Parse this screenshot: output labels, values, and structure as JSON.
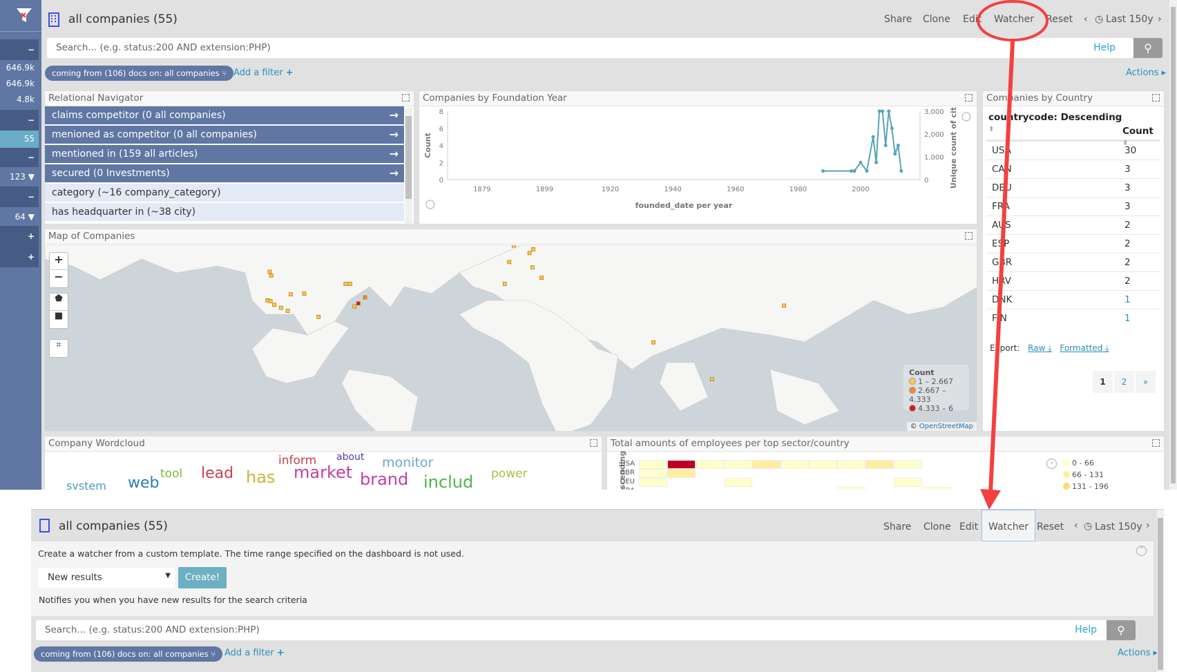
{
  "sidebar": {
    "items": [
      {
        "value": "",
        "control": "−"
      },
      {
        "value": "646.9k"
      },
      {
        "value": "646.9k"
      },
      {
        "value": "4.8k"
      },
      {
        "value": "",
        "control": "−"
      },
      {
        "value": "55"
      },
      {
        "value": "",
        "control": "−"
      },
      {
        "value": "123"
      },
      {
        "value": "",
        "control": "−"
      },
      {
        "value": "64"
      },
      {
        "value": "",
        "control": "+"
      },
      {
        "value": "",
        "control": "+"
      }
    ]
  },
  "header": {
    "title": "all companies (55)",
    "nav": [
      "Share",
      "Clone",
      "Edit",
      "Watcher",
      "Reset"
    ],
    "time_range": "Last 150y"
  },
  "search": {
    "placeholder": "Search... (e.g. status:200 AND extension:PHP)",
    "help": "Help"
  },
  "filters": {
    "pill": "coming from (106) docs on: all companies",
    "add_filter": "Add a filter",
    "actions": "Actions"
  },
  "relational_navigator": {
    "title": "Relational Navigator",
    "items": [
      {
        "label": "claims competitor (0 all companies)",
        "active": true
      },
      {
        "label": "menioned as competitor (0 all companies)",
        "active": true
      },
      {
        "label": "mentioned in (159 all articles)",
        "active": true
      },
      {
        "label": "secured (0 Investments)",
        "active": true
      },
      {
        "label": "category (~16 company_category)",
        "active": false
      },
      {
        "label": "has headquarter in (~38 city)",
        "active": false
      }
    ]
  },
  "chart_data": {
    "type": "line",
    "title": "Companies by Foundation Year",
    "xlabel": "founded_date per year",
    "ylabel": "Count",
    "y2label": "Unique count of city",
    "xlim": [
      1868,
      2019
    ],
    "ylim": [
      0,
      8
    ],
    "y2lim": [
      0,
      3000
    ],
    "xticks": [
      "1879",
      "1899",
      "1920",
      "1940",
      "1960",
      "1980",
      "2000"
    ],
    "yticks": [
      "0",
      "2",
      "4",
      "6",
      "8"
    ],
    "y2ticks": [
      "0",
      "1,000",
      "2,000",
      "3,000"
    ],
    "grid": false,
    "color": "#57a3b8",
    "x": [
      1988,
      1997,
      1998,
      2000,
      2002,
      2004,
      2005,
      2006,
      2007,
      2008,
      2009,
      2010,
      2011,
      2012,
      2013
    ],
    "values": [
      1,
      1,
      1,
      2,
      1,
      5,
      2,
      8,
      8,
      4,
      8,
      6,
      3,
      4,
      1
    ]
  },
  "country_table": {
    "title": "Companies by Country",
    "col1": "countrycode: Descending",
    "col2": "Count",
    "rows": [
      {
        "code": "USA",
        "count": "30"
      },
      {
        "code": "CAN",
        "count": "3"
      },
      {
        "code": "DEU",
        "count": "3"
      },
      {
        "code": "FRA",
        "count": "3"
      },
      {
        "code": "AUS",
        "count": "2"
      },
      {
        "code": "ESP",
        "count": "2"
      },
      {
        "code": "GBR",
        "count": "2"
      },
      {
        "code": "HRV",
        "count": "2"
      },
      {
        "code": "DNK",
        "count": "1"
      },
      {
        "code": "FIN",
        "count": "1"
      }
    ],
    "export_label": "Export:",
    "export_raw": "Raw",
    "export_formatted": "Formatted",
    "pages": [
      "1",
      "2",
      "»"
    ]
  },
  "map": {
    "title": "Map of Companies",
    "legend_title": "Count",
    "legend": [
      {
        "label": "1 – 2.667",
        "color": "#fdc94c"
      },
      {
        "label": "2.667 – 4.333",
        "color": "#f6872f"
      },
      {
        "label": "4.333 – 6",
        "color": "#d7191c"
      }
    ],
    "attribution_prefix": "©",
    "attribution": "OpenStreetMap"
  },
  "wordcloud": {
    "title": "Company Wordcloud",
    "words": [
      {
        "text": "inform",
        "color": "#c9404a"
      },
      {
        "text": "about",
        "color": "#5a3aa8"
      },
      {
        "text": "monitor",
        "color": "#6aa9c6"
      },
      {
        "text": "tool",
        "color": "#7ab83a"
      },
      {
        "text": "lead",
        "color": "#c9404a"
      },
      {
        "text": "has",
        "color": "#c9b43a"
      },
      {
        "text": "market",
        "color": "#c040a0"
      },
      {
        "text": "brand",
        "color": "#c040a0"
      },
      {
        "text": "includ",
        "color": "#4ab84a"
      },
      {
        "text": "power",
        "color": "#a8c040"
      },
      {
        "text": "system",
        "color": "#4a9ac6"
      },
      {
        "text": "web",
        "color": "#2a7ab8"
      }
    ]
  },
  "heatmap": {
    "title": "Total amounts of employees per top sector/country",
    "axis_label": "scending",
    "rows": [
      "USA",
      "GBR",
      "DEU",
      "FRA"
    ],
    "legend": [
      {
        "label": "0 - 66",
        "color": "#ffffcc"
      },
      {
        "label": "66 - 131",
        "color": "#ffeda0"
      },
      {
        "label": "131 - 196",
        "color": "#fed976"
      }
    ]
  },
  "watcher": {
    "description": "Create a watcher from a custom template. The time range specified on the dashboard is not used.",
    "template": "New results",
    "create": "Create!",
    "hint": "Notifies you when you have new results for the search criteria"
  },
  "annotation_color": "#f44040"
}
